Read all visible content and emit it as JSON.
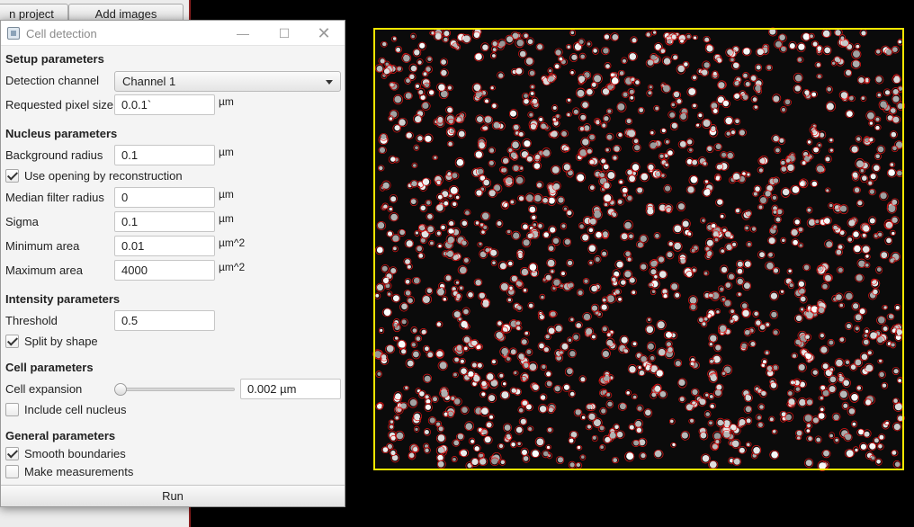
{
  "background_app": {
    "buttons": [
      "n project",
      "Add images"
    ]
  },
  "dialog": {
    "title": "Cell detection",
    "controls": {
      "minimize_icon": "minimize-icon",
      "maximize_icon": "maximize-icon",
      "close_icon": "close-icon"
    },
    "setup": {
      "heading": "Setup parameters",
      "detection_channel_label": "Detection channel",
      "detection_channel_value": "Channel 1",
      "pixel_size_label": "Requested pixel size",
      "pixel_size_value": "0.0.1`",
      "pixel_size_unit": "µm"
    },
    "nucleus": {
      "heading": "Nucleus parameters",
      "background_radius_label": "Background radius",
      "background_radius_value": "0.1",
      "background_radius_unit": "µm",
      "opening_label": "Use opening by reconstruction",
      "opening_checked": true,
      "median_label": "Median filter radius",
      "median_value": "0",
      "median_unit": "µm",
      "sigma_label": "Sigma",
      "sigma_value": "0.1",
      "sigma_unit": "µm",
      "min_area_label": "Minimum area",
      "min_area_value": "0.01",
      "min_area_unit": "µm^2",
      "max_area_label": "Maximum area",
      "max_area_value": "4000",
      "max_area_unit": "µm^2"
    },
    "intensity": {
      "heading": "Intensity parameters",
      "threshold_label": "Threshold",
      "threshold_value": "0.5",
      "split_label": "Split by shape",
      "split_checked": true
    },
    "cell": {
      "heading": "Cell parameters",
      "expansion_label": "Cell expansion",
      "expansion_value": "0.002 µm",
      "expansion_slider_level": 0,
      "include_nucleus_label": "Include cell nucleus",
      "include_nucleus_checked": false
    },
    "general": {
      "heading": "General parameters",
      "smooth_label": "Smooth boundaries",
      "smooth_checked": true,
      "measurements_label": "Make measurements",
      "measurements_checked": false
    },
    "run_label": "Run"
  },
  "viewer": {
    "annotation_color": "#f2e600",
    "detection_color": "#e01515",
    "nucleus_color": "#dcdcdc"
  }
}
